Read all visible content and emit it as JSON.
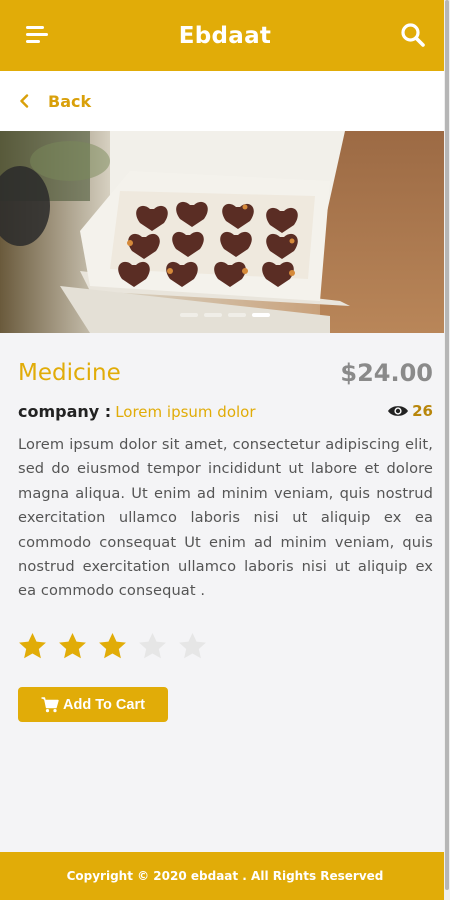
{
  "header": {
    "title": "Ebdaat",
    "menu_icon": "hamburger-menu-icon",
    "search_icon": "search-icon"
  },
  "nav": {
    "back_label": "Back",
    "back_icon": "chevron-left-icon"
  },
  "carousel": {
    "image": "box of heart-shaped chocolates",
    "slide_count": 4,
    "active_slide": 4
  },
  "product": {
    "name": "Medicine",
    "price": "$24.00",
    "company_label": "company :",
    "company_value": "Lorem ipsum dolor",
    "views": "26",
    "description": "Lorem ipsum dolor sit amet, consectetur adipiscing elit, sed do eiusmod tempor incididunt ut labore et dolore magna aliqua. Ut enim ad minim veniam, quis nostrud exercitation ullamco laboris nisi ut aliquip ex ea commodo consequat Ut enim ad minim veniam, quis nostrud exercitation ullamco laboris nisi ut aliquip ex ea commodo consequat .",
    "rating": 3,
    "rating_max": 5
  },
  "actions": {
    "add_to_cart": "Add To Cart",
    "cart_icon": "shopping-cart-icon"
  },
  "footer": {
    "copyright": "Copyright © 2020 ebdaat . All Rights Reserved"
  },
  "colors": {
    "accent": "#e1ac08",
    "price": "#8a8a8a",
    "star_filled": "#e1ac08",
    "star_empty": "#e6e6e6"
  }
}
